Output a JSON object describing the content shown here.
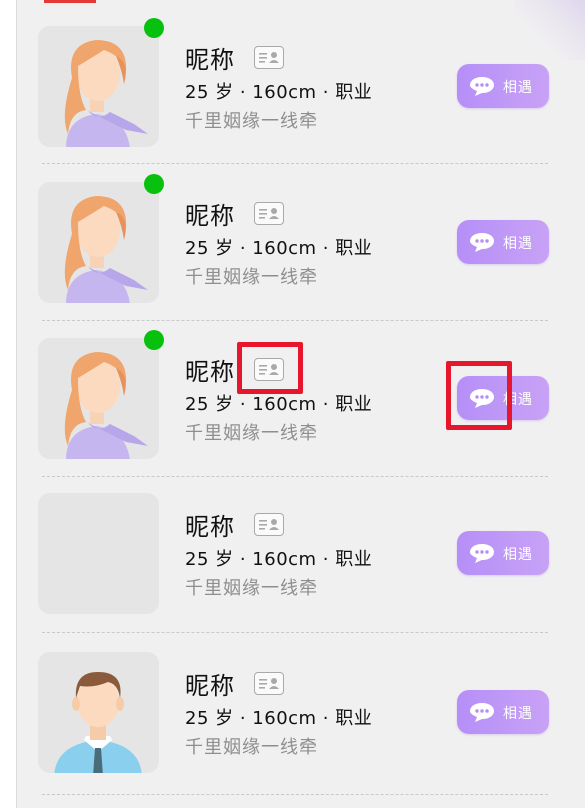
{
  "list": {
    "items": [
      {
        "nickname": "昵称",
        "meta": "25 岁 · 160cm · 职业",
        "motto": "千里姻缘一线牵",
        "online": true,
        "avatar": "female-avatar",
        "button": "相遇"
      },
      {
        "nickname": "昵称",
        "meta": "25 岁 · 160cm · 职业",
        "motto": "千里姻缘一线牵",
        "online": true,
        "avatar": "female-avatar",
        "button": "相遇"
      },
      {
        "nickname": "昵称",
        "meta": "25 岁 · 160cm · 职业",
        "motto": "千里姻缘一线牵",
        "online": true,
        "avatar": "female-avatar",
        "button": "相遇"
      },
      {
        "nickname": "昵称",
        "meta": "25 岁 · 160cm · 职业",
        "motto": "千里姻缘一线牵",
        "online": false,
        "avatar": "empty-avatar",
        "button": "相遇"
      },
      {
        "nickname": "昵称",
        "meta": "25 岁 · 160cm · 职业",
        "motto": "千里姻缘一线牵",
        "online": false,
        "avatar": "male-avatar",
        "button": "相遇"
      }
    ]
  },
  "colors": {
    "online": "#07c10e",
    "button_gradient_start": "#b58ff7",
    "button_gradient_end": "#c8a2f6",
    "highlight": "#e8162d"
  },
  "icons": {
    "id_card": "id-card-icon",
    "chat": "chat-bubble-icon"
  }
}
